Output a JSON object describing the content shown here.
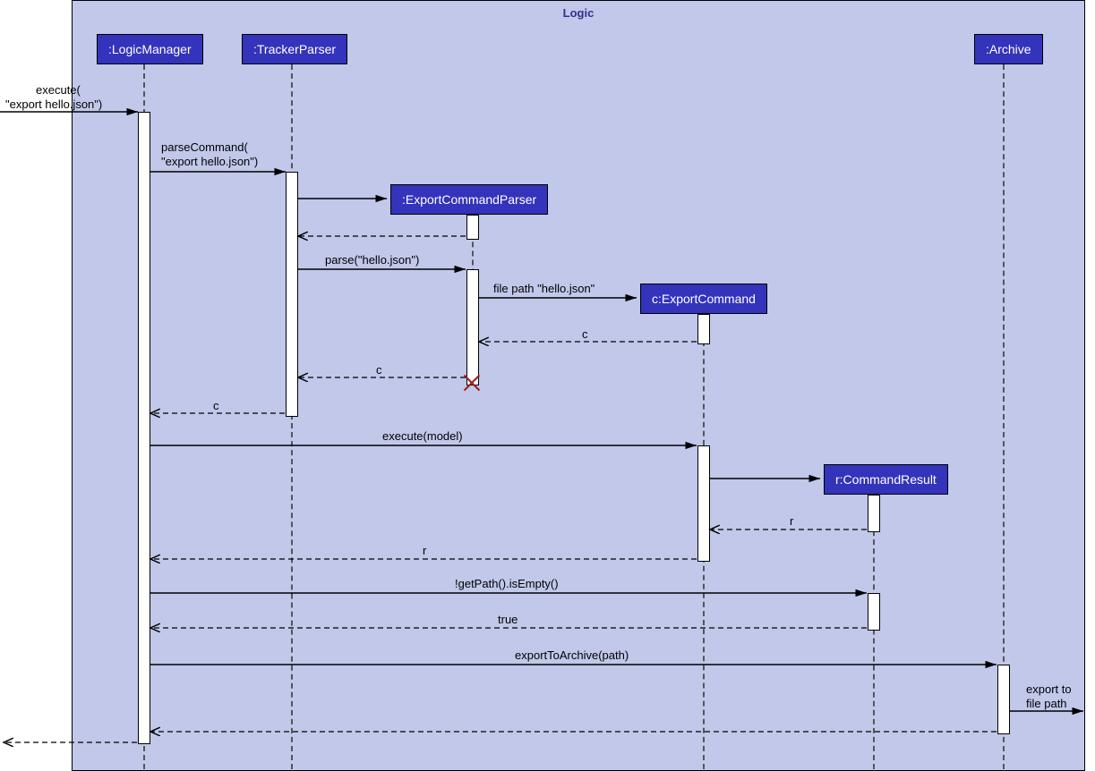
{
  "frame": {
    "title": "Logic"
  },
  "participants": {
    "logicManager": ":LogicManager",
    "trackerParser": ":TrackerParser",
    "exportCommandParser": ":ExportCommandParser",
    "exportCommand": "c:ExportCommand",
    "commandResult": "r:CommandResult",
    "archive": ":Archive"
  },
  "messages": {
    "m1a": "execute(",
    "m1b": "\"export hello.json\")",
    "m2a": "parseCommand(",
    "m2b": "\"export hello.json\")",
    "m3": "parse(\"hello.json\")",
    "m4": "file path \"hello.json\"",
    "m5": "c",
    "m6": "c",
    "m7": "c",
    "m8": "execute(model)",
    "m9": "r",
    "m10": "r",
    "m11": "!getPath().isEmpty()",
    "m12": "true",
    "m13": "exportToArchive(path)",
    "m14a": "export to",
    "m14b": "file path"
  },
  "diagram_meta": {
    "type": "UML sequence diagram",
    "lifelines": [
      "LogicManager",
      "TrackerParser",
      "ExportCommandParser",
      "ExportCommand",
      "CommandResult",
      "Archive"
    ],
    "destroyed": [
      "ExportCommandParser"
    ]
  }
}
